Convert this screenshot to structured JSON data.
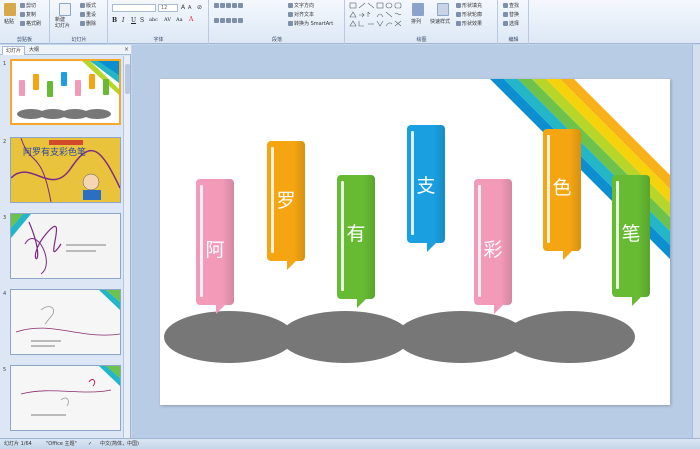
{
  "ribbon": {
    "groups": [
      {
        "label": "剪贴板"
      },
      {
        "label": "幻灯片"
      },
      {
        "label": "字体"
      },
      {
        "label": "段落"
      },
      {
        "label": "绘图"
      },
      {
        "label": "编辑"
      }
    ],
    "clipboard": {
      "paste": "粘贴",
      "cut": "剪切",
      "copy": "复制",
      "format_painter": "格式刷"
    },
    "slides": {
      "new_slide": "新建\n幻灯片",
      "layout": "版式",
      "reset": "重设",
      "delete": "删除"
    },
    "font": {
      "font_size": "12",
      "format_buttons": [
        "B",
        "I",
        "U",
        "S",
        "abc",
        "AV",
        "Aa",
        "A"
      ]
    },
    "paragraph": {
      "text_direction": "文字方向",
      "align_text": "对齐文本",
      "convert_smartart": "转换为 SmartArt"
    },
    "drawing": {
      "arrange": "排列",
      "quick_styles": "快速样式",
      "shape_fill": "形状填充",
      "shape_outline": "形状轮廓",
      "shape_effects": "形状效果"
    },
    "editing": {
      "find": "查找",
      "replace": "替换",
      "select": "选择"
    }
  },
  "panel": {
    "tabs": [
      "幻灯片",
      "大纲"
    ],
    "close_glyph": "×",
    "thumbnails": [
      {
        "num": "1",
        "selected": true
      },
      {
        "num": "2",
        "selected": false,
        "title": "阿罗有支彩色笔"
      },
      {
        "num": "3",
        "selected": false
      },
      {
        "num": "4",
        "selected": false
      },
      {
        "num": "5",
        "selected": false
      }
    ]
  },
  "slide": {
    "cards": [
      {
        "char": "阿",
        "color": "#f29ab8"
      },
      {
        "char": "罗",
        "color": "#f5a511"
      },
      {
        "char": "有",
        "color": "#66bb33"
      },
      {
        "char": "支",
        "color": "#1a9fe0"
      },
      {
        "char": "彩",
        "color": "#f29ab8"
      },
      {
        "char": "色",
        "color": "#f5a511"
      },
      {
        "char": "笔",
        "color": "#66bb33"
      }
    ],
    "ellipse_color": "#777777",
    "corner_stripe_colors": [
      "#0b8fd1",
      "#22b6c8",
      "#6cc24a",
      "#b7d629",
      "#f5d20c",
      "#f7b21a"
    ]
  },
  "status": {
    "slide_of": "幻灯片 1/64",
    "theme": "\"Office 主题\"",
    "language": "中文(简体，中国)"
  }
}
